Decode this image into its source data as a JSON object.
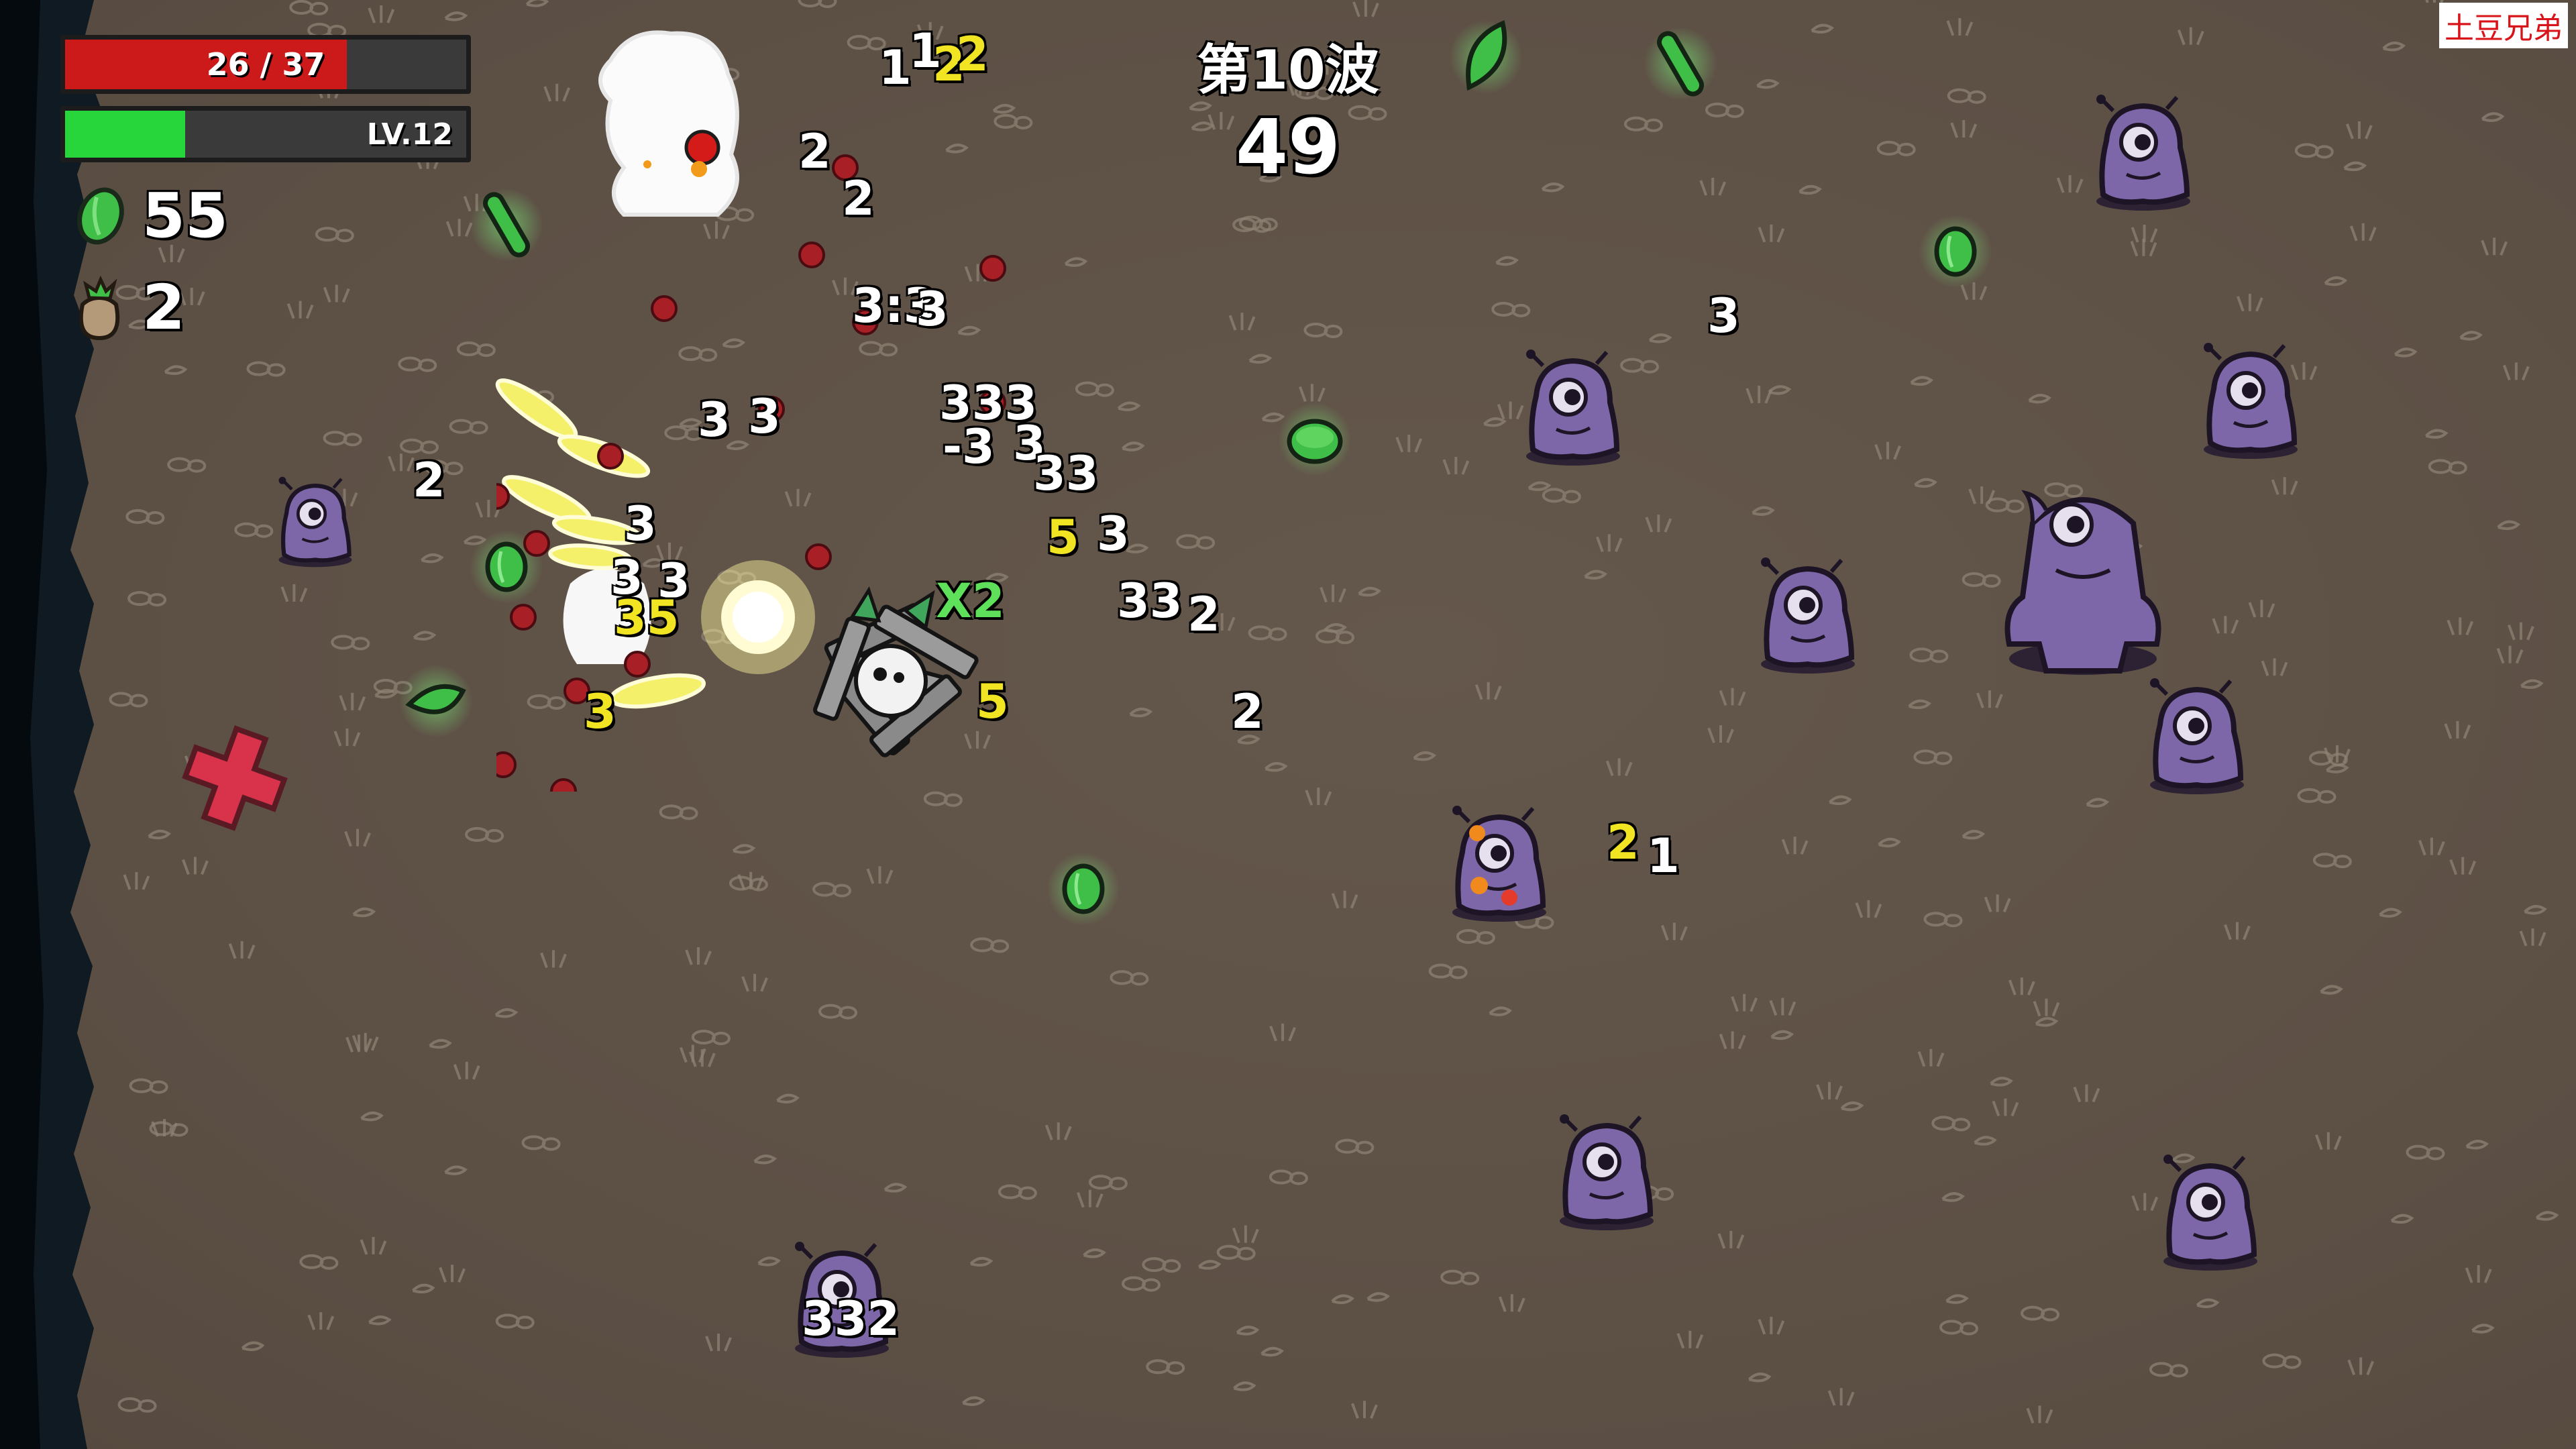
{
  "hud": {
    "hp": {
      "current": 26,
      "max": 37,
      "text": "26 / 37",
      "color": "#cc1a1a"
    },
    "xp": {
      "fraction": 0.3,
      "level_text": "LV.12",
      "color": "#27d63a"
    },
    "materials": {
      "count": "55",
      "icon": "green-material-icon"
    },
    "bag": {
      "count": "2",
      "icon": "loot-bag-icon"
    }
  },
  "wave": {
    "label": "第10波",
    "timer": "49"
  },
  "watermark": "土豆兄弟",
  "damage_numbers": [
    {
      "text": "1",
      "color": "white"
    },
    {
      "text": "1",
      "color": "white"
    },
    {
      "text": "2",
      "color": "yellow"
    },
    {
      "text": "2",
      "color": "yellow"
    },
    {
      "text": "2",
      "color": "white"
    },
    {
      "text": "2",
      "color": "white"
    },
    {
      "text": "3:3",
      "color": "white"
    },
    {
      "text": "3",
      "color": "white"
    },
    {
      "text": "3",
      "color": "white"
    },
    {
      "text": "3",
      "color": "white"
    },
    {
      "text": "333",
      "color": "white"
    },
    {
      "text": "-3",
      "color": "white"
    },
    {
      "text": "3",
      "color": "white"
    },
    {
      "text": "33",
      "color": "white"
    },
    {
      "text": "5",
      "color": "yellow"
    },
    {
      "text": "3",
      "color": "white"
    },
    {
      "text": "33",
      "color": "white"
    },
    {
      "text": "2",
      "color": "white"
    },
    {
      "text": "2",
      "color": "white"
    },
    {
      "text": "2",
      "color": "white"
    },
    {
      "text": "3",
      "color": "white"
    },
    {
      "text": "3",
      "color": "white"
    },
    {
      "text": "3",
      "color": "white"
    },
    {
      "text": "35",
      "color": "yellow"
    },
    {
      "text": "3",
      "color": "yellow"
    },
    {
      "text": "5",
      "color": "yellow"
    },
    {
      "text": "X2",
      "color": "green"
    },
    {
      "text": "2",
      "color": "yellow"
    },
    {
      "text": "1",
      "color": "white"
    },
    {
      "text": "332",
      "color": "white"
    }
  ],
  "colors": {
    "ground": "#5e5146",
    "enemy": "#7d67a8",
    "enemy_dark": "#3a2c55",
    "material": "#3fbf47",
    "heal_cross": "#d8334a"
  }
}
